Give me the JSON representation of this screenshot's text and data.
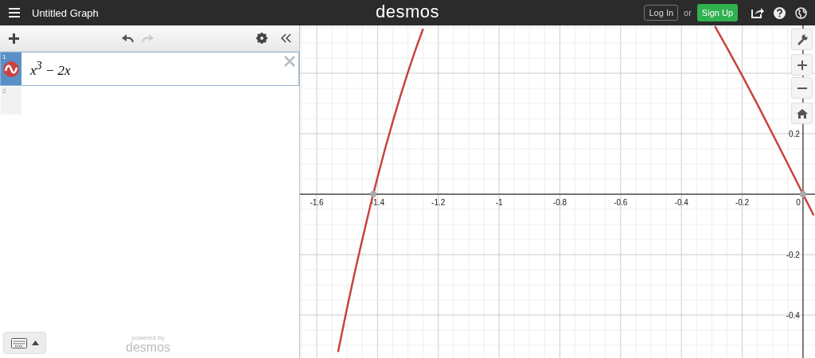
{
  "header": {
    "title": "Untitled Graph",
    "logo": "desmos",
    "login": "Log In",
    "or": "or",
    "signup": "Sign Up"
  },
  "expressions": [
    {
      "index": "1",
      "math": "x$^{3}$ − 2x",
      "selected": true,
      "color": "#c74440"
    },
    {
      "index": "2",
      "selected": false
    }
  ],
  "footer": {
    "powered_by": "powered by",
    "brand": "desmos"
  },
  "graph": {
    "chart_data": {
      "type": "line",
      "xlim": [
        -1.655,
        0.0395
      ],
      "ylim": [
        -0.542,
        0.558
      ],
      "xticks": [
        {
          "value": -1.6,
          "label": "-1.6"
        },
        {
          "value": -1.4,
          "label": "-1.4"
        },
        {
          "value": -1.2,
          "label": "-1.2"
        },
        {
          "value": -1,
          "label": "-1"
        },
        {
          "value": -0.8,
          "label": "-0.8"
        },
        {
          "value": -0.6,
          "label": "-0.6"
        },
        {
          "value": -0.4,
          "label": "-0.4"
        },
        {
          "value": -0.2,
          "label": "-0.2"
        },
        {
          "value": 0,
          "label": "0"
        }
      ],
      "yticks": [
        {
          "value": 0.2,
          "label": "0.2"
        },
        {
          "value": -0.2,
          "label": "-0.2"
        },
        {
          "value": -0.4,
          "label": "-0.4"
        }
      ],
      "grid": true,
      "x": [
        -1.53,
        -1.5,
        -1.475,
        -1.45,
        -1.425,
        -1.414,
        -1.4,
        -1.375,
        -1.35,
        -1.325,
        -1.3,
        -1.275,
        -1.25,
        -0.29,
        -0.25,
        -0.2,
        -0.15,
        -0.1,
        -0.05,
        0,
        0.035
      ],
      "series": [
        {
          "color": "#c74440",
          "values": [
            -0.522,
            -0.375,
            -0.259,
            -0.149,
            -0.044,
            0,
            0.056,
            0.151,
            0.24,
            0.324,
            0.403,
            0.478,
            0.547,
            null,
            null,
            null,
            null,
            null,
            null,
            null,
            null
          ]
        },
        {
          "color": "#c74440",
          "values": [
            null,
            null,
            null,
            null,
            null,
            null,
            null,
            null,
            null,
            null,
            null,
            null,
            null,
            0.556,
            0.484,
            0.392,
            0.297,
            0.199,
            0.1,
            0,
            -0.07
          ]
        }
      ]
    }
  }
}
